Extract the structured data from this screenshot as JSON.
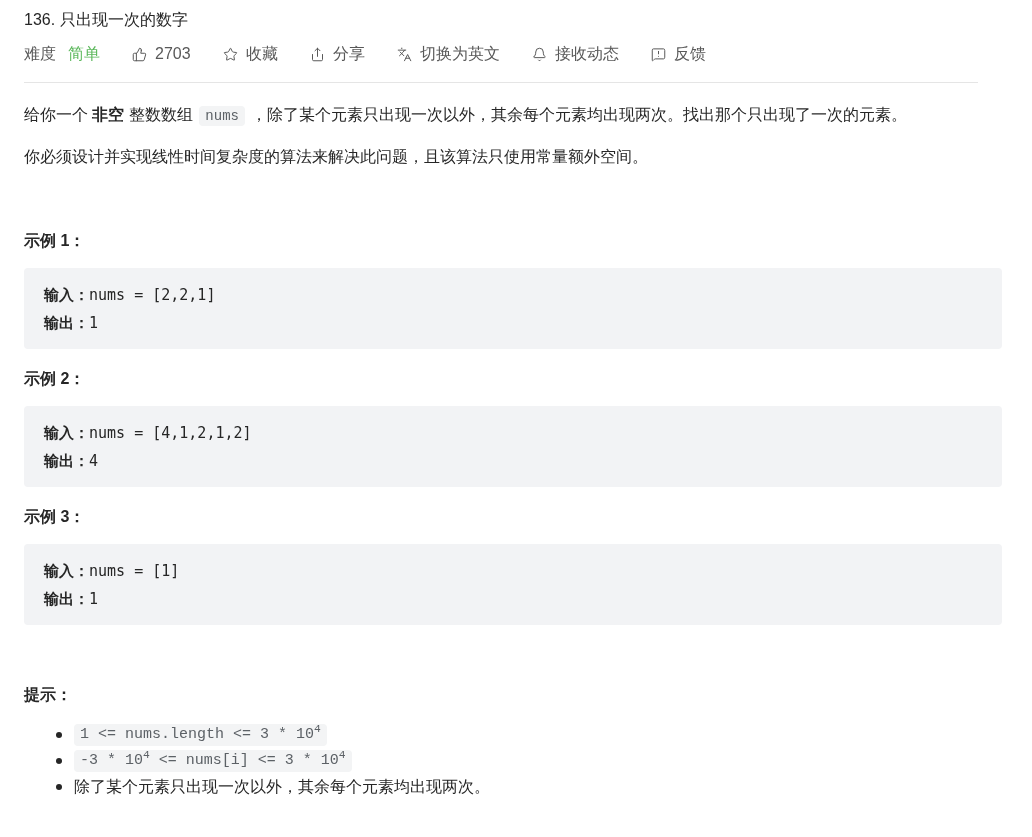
{
  "title": "136. 只出现一次的数字",
  "meta": {
    "difficulty_label": "难度",
    "difficulty": "简单",
    "actions": [
      {
        "kind": "like",
        "label": "2703"
      },
      {
        "kind": "star",
        "label": "收藏"
      },
      {
        "kind": "share",
        "label": "分享"
      },
      {
        "kind": "translate",
        "label": "切换为英文"
      },
      {
        "kind": "bell",
        "label": "接收动态"
      },
      {
        "kind": "feedback",
        "label": "反馈"
      }
    ]
  },
  "description": [
    [
      {
        "kind": "text",
        "text": "给你一个 **非空** 整数数组 "
      },
      {
        "kind": "code",
        "text": "nums"
      },
      {
        "kind": "text",
        "text": " ，除了某个元素只出现一次以外，其余每个元素均出现两次。找出那个只出现了一次的元素。"
      }
    ],
    [
      {
        "kind": "text",
        "text": "你必须设计并实现线性时间复杂度的算法来解决此问题，且该算法只使用常量额外空间。"
      }
    ]
  ],
  "examples": [
    {
      "heading": "示例 1：",
      "lines": [
        "**输入：**nums = [2,2,1]",
        "**输出：**1"
      ]
    },
    {
      "heading": "示例 2：",
      "lines": [
        "**输入：**nums = [4,1,2,1,2]",
        "**输出：**4"
      ]
    },
    {
      "heading": "示例 3：",
      "lines": [
        "**输入：**nums = [1]",
        "**输出：**1"
      ]
    }
  ],
  "hints": {
    "heading": "提示：",
    "items": [
      {
        "kind": "code",
        "text": "1 <= nums.length <= 3 * 10$^{4}$"
      },
      {
        "kind": "code",
        "text": "-3 * 10$^{4}$ <= nums[i] <= 3 * 10$^{4}$"
      },
      {
        "kind": "text",
        "text": "除了某个元素只出现一次以外，其余每个元素均出现两次。"
      }
    ]
  }
}
